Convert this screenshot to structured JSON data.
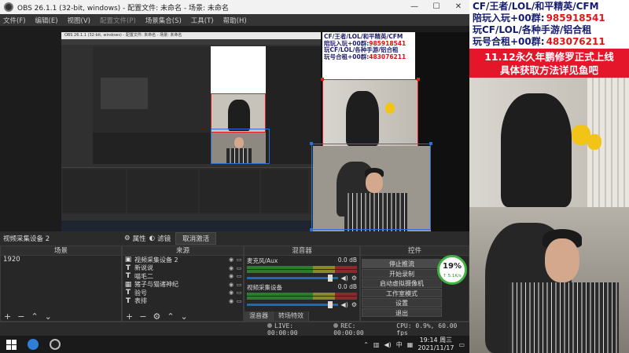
{
  "window": {
    "title": "OBS 26.1.1 (32-bit, windows) - 配置文件: 未命名 - 场景: 未命名",
    "controls": [
      "—",
      "☐",
      "✕"
    ]
  },
  "menu": [
    "文件(F)",
    "编辑(E)",
    "视图(V)",
    "配置文件(P)",
    "场景集合(S)",
    "工具(T)",
    "帮助(H)"
  ],
  "source_bar": {
    "current_source": "视频采集设备 2",
    "properties_label": "属性",
    "filters_label": "滤镜",
    "deactivate_label": "取消激活"
  },
  "docks": {
    "scenes_title": "场景",
    "sources_title": "来源",
    "mixer_title": "混音器",
    "controls_title": "控件"
  },
  "scenes": [
    "1920"
  ],
  "sources": [
    {
      "icon": "camera",
      "label": "视频采集设备 2"
    },
    {
      "icon": "text",
      "label": "新说说"
    },
    {
      "icon": "text",
      "label": "喵毛二"
    },
    {
      "icon": "image",
      "label": "猪子与猫诸神纪"
    },
    {
      "icon": "text",
      "label": "验号"
    },
    {
      "icon": "text",
      "label": "表排"
    }
  ],
  "mixer": [
    {
      "name": "麦克风/Aux",
      "db": "0.0 dB",
      "level": 0.92
    },
    {
      "name": "视频采集设备",
      "db": "0.0 dB",
      "level": 0.92
    }
  ],
  "mixer_tabs": [
    "混音器",
    "转场特效"
  ],
  "controls": [
    "停止推流",
    "开始录制",
    "启动虚拟摄像机",
    "工作室模式",
    "设置",
    "退出"
  ],
  "gauge": {
    "percent": "19%",
    "speed": "↑ 5.1K/s"
  },
  "status": {
    "live": "LIVE: 00:00:00",
    "rec": "REC: 00:00:00",
    "cpu": "CPU: 0.9%, 60.00 fps"
  },
  "taskbar": {
    "ime": "中",
    "time": "19:14 周三",
    "date": "2021/11/17"
  },
  "promo": {
    "lines": [
      {
        "text": "CF/王者/LOL/和平精英/CFM",
        "num": ""
      },
      {
        "text": "陪玩入玩+00群:",
        "num": "985918541"
      },
      {
        "text": "玩CF/LOL/各种手游/铝合租",
        "num": ""
      },
      {
        "text": "玩号合租+00群:",
        "num": "483076211"
      }
    ],
    "banner_line1": "11.12永久年鹏修罗正式上线",
    "banner_line2": "具体获取方法详见鱼吧"
  },
  "icons": {
    "properties": "gear-icon",
    "filters": "filter-icon",
    "add": "plus-icon",
    "remove": "minus-icon",
    "up": "arrow-up-icon",
    "down": "arrow-down-icon"
  }
}
